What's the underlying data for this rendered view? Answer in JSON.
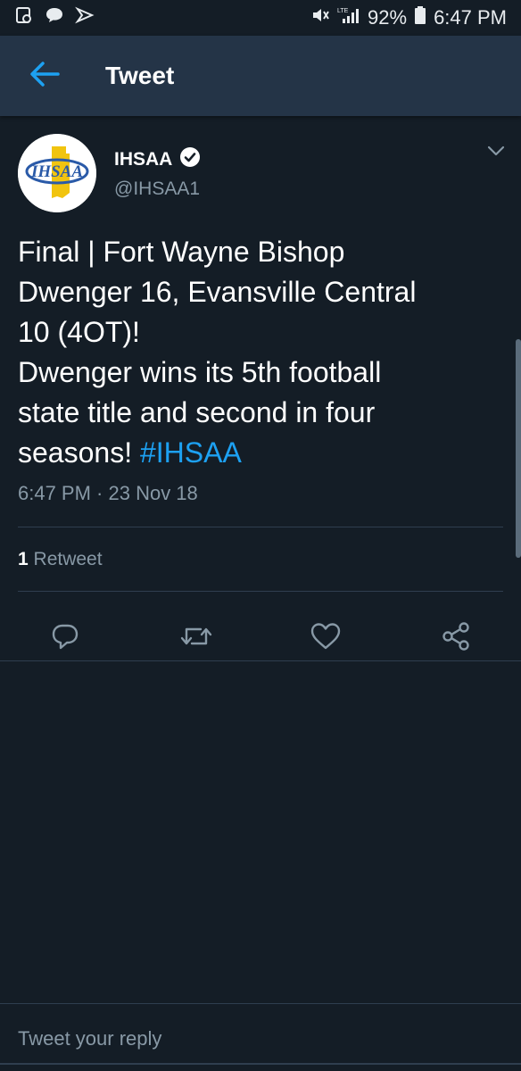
{
  "status_bar": {
    "battery": "92%",
    "time": "6:47 PM",
    "network": "LTE"
  },
  "appbar": {
    "title": "Tweet"
  },
  "tweet": {
    "author_name": "IHSAA",
    "author_handle": "@IHSAA1",
    "avatar_text": "IHSAA",
    "verified": true,
    "body_lines": [
      "Final | Fort Wayne Bishop",
      "Dwenger 16, Evansville Central",
      "10 (4OT)!",
      "Dwenger wins its 5th football",
      "state title and second in four"
    ],
    "body_last_line_prefix": "seasons! ",
    "hashtag": "#IHSAA",
    "timestamp": "6:47 PM · 23 Nov 18",
    "retweet_count": "1",
    "retweet_label": " Retweet"
  },
  "reply": {
    "placeholder": "Tweet your reply"
  },
  "colors": {
    "background": "#141d26",
    "appbar": "#243447",
    "accent": "#1da1f2",
    "muted": "#8899a6"
  },
  "icons": {
    "back": "back-arrow-icon",
    "verified": "verified-badge-icon",
    "caret": "chevron-down-icon",
    "reply": "reply-icon",
    "retweet": "retweet-icon",
    "like": "heart-icon",
    "share": "share-icon"
  }
}
